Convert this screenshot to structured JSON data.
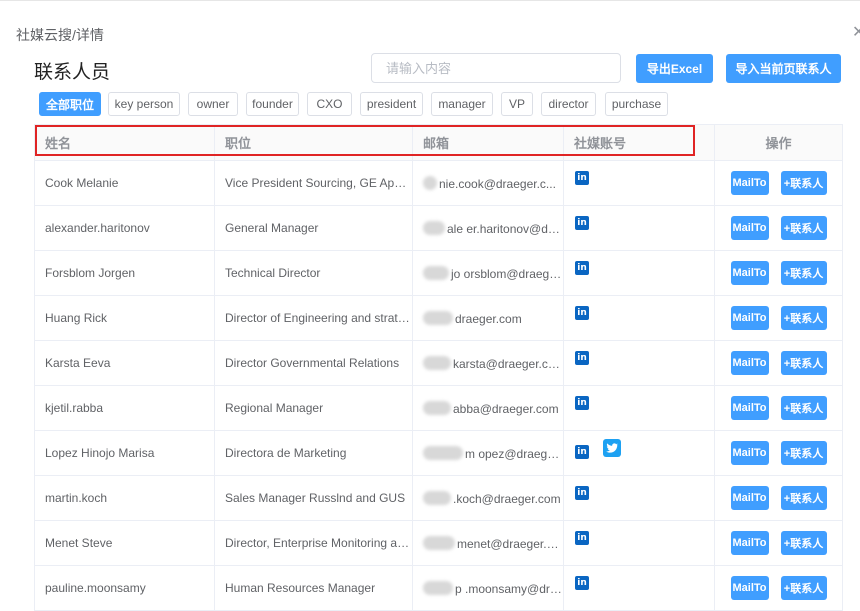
{
  "breadcrumb": "社媒云搜/详情",
  "close_icon": "close-icon",
  "page_title": "联系人员",
  "search": {
    "placeholder": "请输入内容",
    "value": ""
  },
  "buttons": {
    "export": "导出Excel",
    "import": "导入当前页联系人"
  },
  "filters": [
    "全部职位",
    "key person",
    "owner",
    "founder",
    "CXO",
    "president",
    "manager",
    "VP",
    "director",
    "purchase"
  ],
  "active_filter": "全部职位",
  "table": {
    "headers": {
      "name": "姓名",
      "position": "职位",
      "email": "邮箱",
      "social": "社媒账号",
      "actions": "操作"
    },
    "action_labels": {
      "mail": "MailTo",
      "add": "+联系人"
    },
    "rows": [
      {
        "name": "Cook Melanie",
        "position": "Vice President Sourcing, GE Appli...",
        "email": "nie.cook@draeger.c...",
        "social": [
          "linkedin"
        ]
      },
      {
        "name": "alexander.haritonov",
        "position": "General Manager",
        "email": "ale er.haritonov@dra...",
        "social": [
          "linkedin"
        ]
      },
      {
        "name": "Forsblom Jorgen",
        "position": "Technical Director",
        "email": "jo orsblom@draeger....",
        "social": [
          "linkedin"
        ]
      },
      {
        "name": "Huang Rick",
        "position": "Director of Engineering and strateg...",
        "email": "draeger.com",
        "social": [
          "linkedin"
        ]
      },
      {
        "name": "Karsta Eeva",
        "position": "Director Governmental Relations",
        "email": "karsta@draeger.com",
        "social": [
          "linkedin"
        ]
      },
      {
        "name": "kjetil.rabba",
        "position": "Regional Manager",
        "email": "abba@draeger.com",
        "social": [
          "linkedin"
        ]
      },
      {
        "name": "Lopez Hinojo Marisa",
        "position": "Directora de Marketing",
        "email": "m opez@draeger.com",
        "social": [
          "linkedin",
          "twitter"
        ]
      },
      {
        "name": "martin.koch",
        "position": "Sales Manager Russlnd and GUS",
        "email": ".koch@draeger.com",
        "social": [
          "linkedin"
        ]
      },
      {
        "name": "Menet Steve",
        "position": "Director, Enterprise Monitoring and...",
        "email": "menet@draeger.com",
        "social": [
          "linkedin"
        ]
      },
      {
        "name": "pauline.moonsamy",
        "position": "Human Resources Manager",
        "email": "p .moonsamy@dra...",
        "social": [
          "linkedin"
        ]
      }
    ]
  },
  "colors": {
    "primary": "#409eff",
    "highlight_border": "#e02424",
    "linkedin": "#0a66c2",
    "twitter": "#1da1f2"
  }
}
